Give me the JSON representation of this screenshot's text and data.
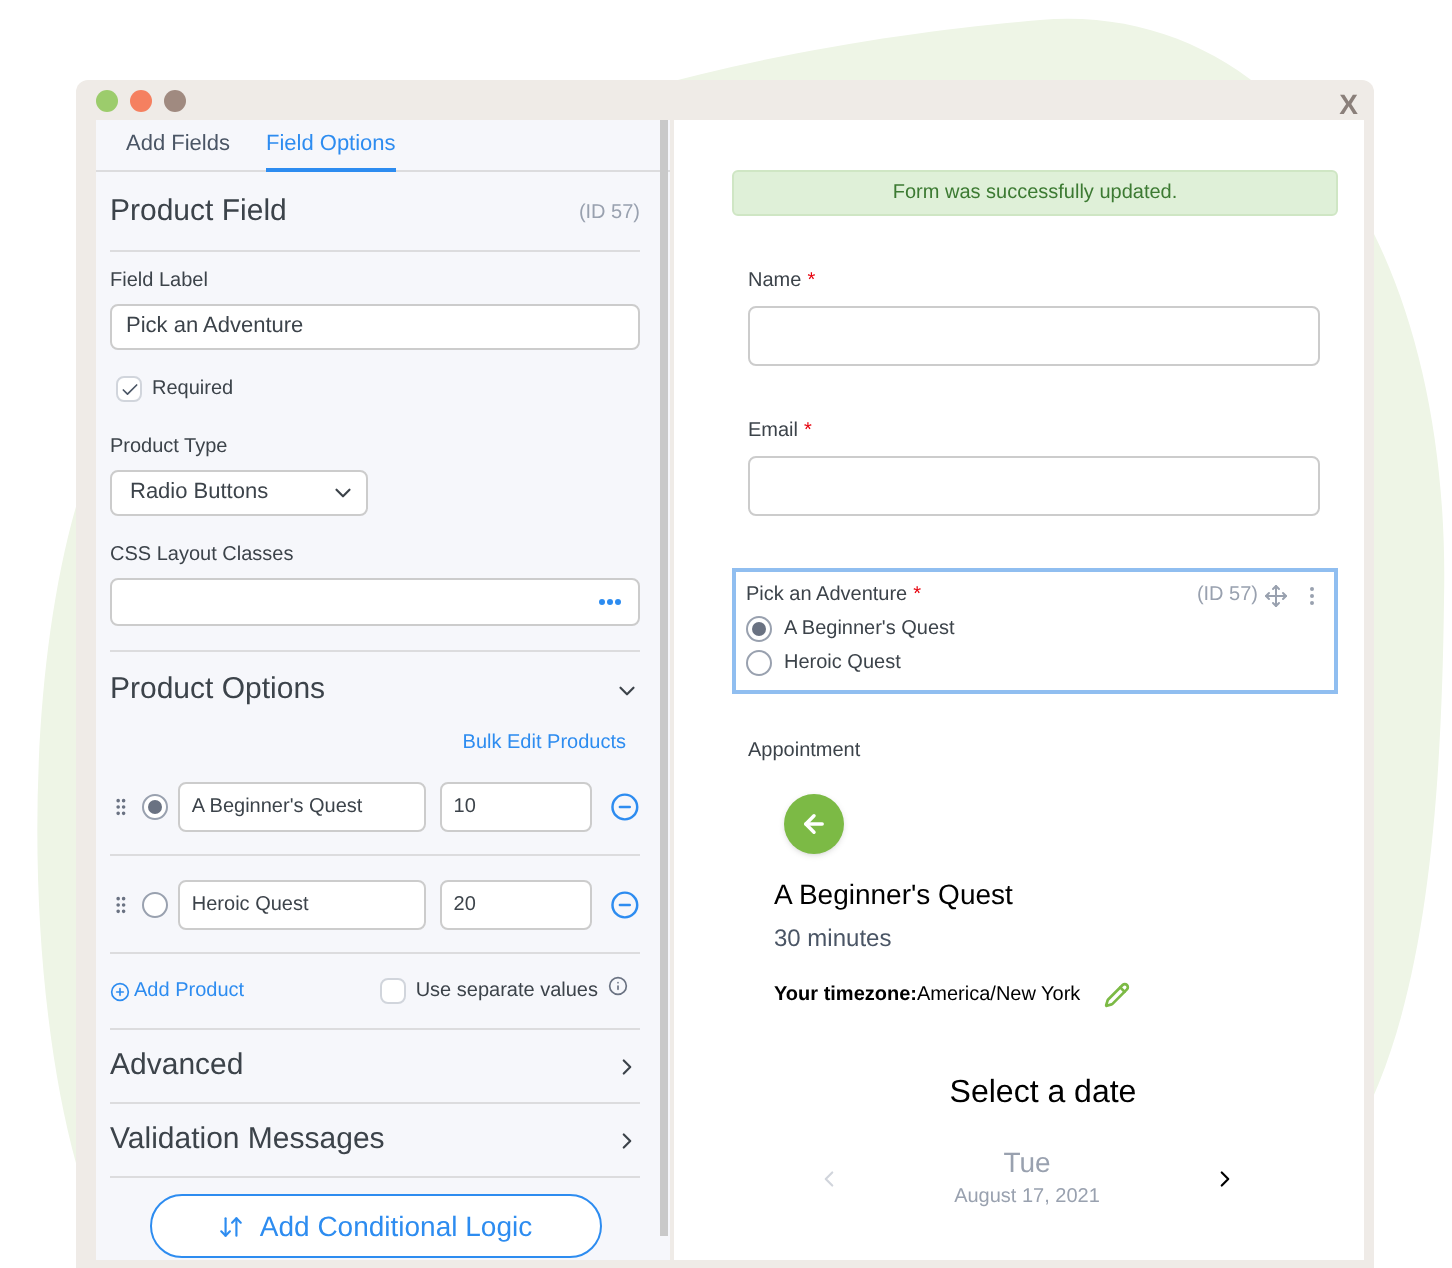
{
  "window": {
    "close": "X"
  },
  "tabs": [
    {
      "label": "Add Fields",
      "selected": false
    },
    {
      "label": "Field Options",
      "selected": true
    }
  ],
  "field_header": {
    "title": "Product Field",
    "id": "(ID 57)"
  },
  "field_label": {
    "label": "Field Label",
    "value": "Pick an Adventure"
  },
  "required": {
    "label": "Required",
    "checked": true
  },
  "product_type": {
    "label": "Product Type",
    "value": "Radio Buttons"
  },
  "css_classes": {
    "label": "CSS Layout Classes"
  },
  "product_options": {
    "title": "Product Options",
    "expanded": true,
    "bulk_edit": "Bulk Edit Products",
    "items": [
      {
        "name": "A Beginner's Quest",
        "price": "10",
        "selected": true
      },
      {
        "name": "Heroic Quest",
        "price": "20",
        "selected": false
      }
    ],
    "add_product": "Add Product",
    "separate_values": {
      "label": "Use separate values",
      "checked": false
    }
  },
  "sections": [
    {
      "title": "Advanced",
      "expanded": false
    },
    {
      "title": "Validation Messages",
      "expanded": false
    }
  ],
  "conditional_logic_button": "Add Conditional Logic",
  "notice": "Form was successfully updated.",
  "fields": [
    {
      "label": "Name",
      "required": true,
      "required_mark": "*"
    },
    {
      "label": "Email",
      "required": true,
      "required_mark": "*"
    }
  ],
  "product_field": {
    "label": "Pick an Adventure",
    "required": true,
    "required_mark": "*",
    "id": "(ID 57)",
    "options": [
      {
        "label": "A Beginner's Quest",
        "selected": true
      },
      {
        "label": "Heroic Quest",
        "selected": false
      }
    ]
  },
  "appointment": {
    "label": "Appointment",
    "service": "A Beginner's Quest",
    "duration": "30 minutes",
    "timezone_label": "Your timezone:",
    "timezone": "America/New York",
    "heading": "Select a date",
    "day": "Tue",
    "date": "August 17, 2021"
  }
}
